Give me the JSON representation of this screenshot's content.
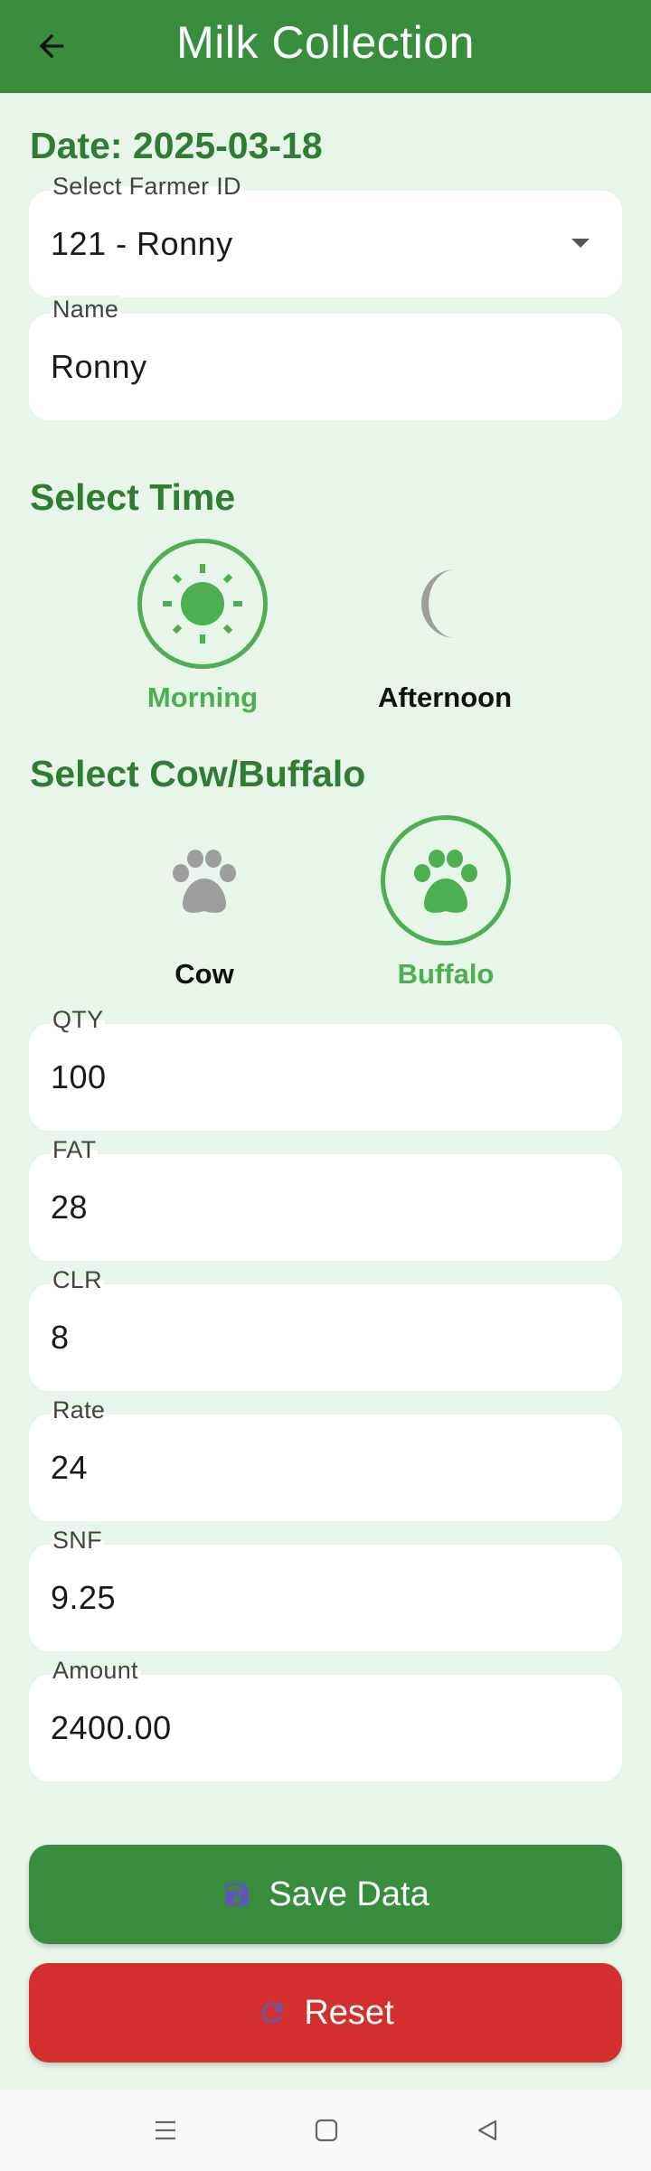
{
  "header": {
    "title": "Milk Collection",
    "back_icon": "arrow-left-icon"
  },
  "date_label": "Date: 2025-03-18",
  "farmer": {
    "label": "Select Farmer ID",
    "value": "121 - Ronny"
  },
  "name": {
    "label": "Name",
    "value": "Ronny"
  },
  "time_section": {
    "title": "Select Time",
    "options": [
      {
        "label": "Morning",
        "icon": "sun-icon",
        "selected": true
      },
      {
        "label": "Afternoon",
        "icon": "moon-icon",
        "selected": false
      }
    ]
  },
  "animal_section": {
    "title": "Select Cow/Buffalo",
    "options": [
      {
        "label": "Cow",
        "icon": "paw-icon",
        "selected": false
      },
      {
        "label": "Buffalo",
        "icon": "paw-icon",
        "selected": true
      }
    ]
  },
  "fields": [
    {
      "label": "QTY",
      "value": "100"
    },
    {
      "label": "FAT",
      "value": "28"
    },
    {
      "label": "CLR",
      "value": "8"
    },
    {
      "label": "Rate",
      "value": "24"
    },
    {
      "label": "SNF",
      "value": "9.25"
    },
    {
      "label": "Amount",
      "value": "2400.00"
    }
  ],
  "buttons": {
    "save": {
      "label": "Save Data",
      "icon": "floppy-disk-icon"
    },
    "reset": {
      "label": "Reset",
      "icon": "refresh-icon"
    }
  },
  "nav": {
    "menu_icon": "recent-apps-icon",
    "home_icon": "home-square-icon",
    "back_icon": "back-triangle-icon"
  },
  "colors": {
    "primary": "#388e3c",
    "accent": "#4caf50",
    "title_green": "#2e7d32",
    "background": "#e8f5e9",
    "reset": "#d32f2f",
    "inactive_icon": "#9e9e9e"
  }
}
